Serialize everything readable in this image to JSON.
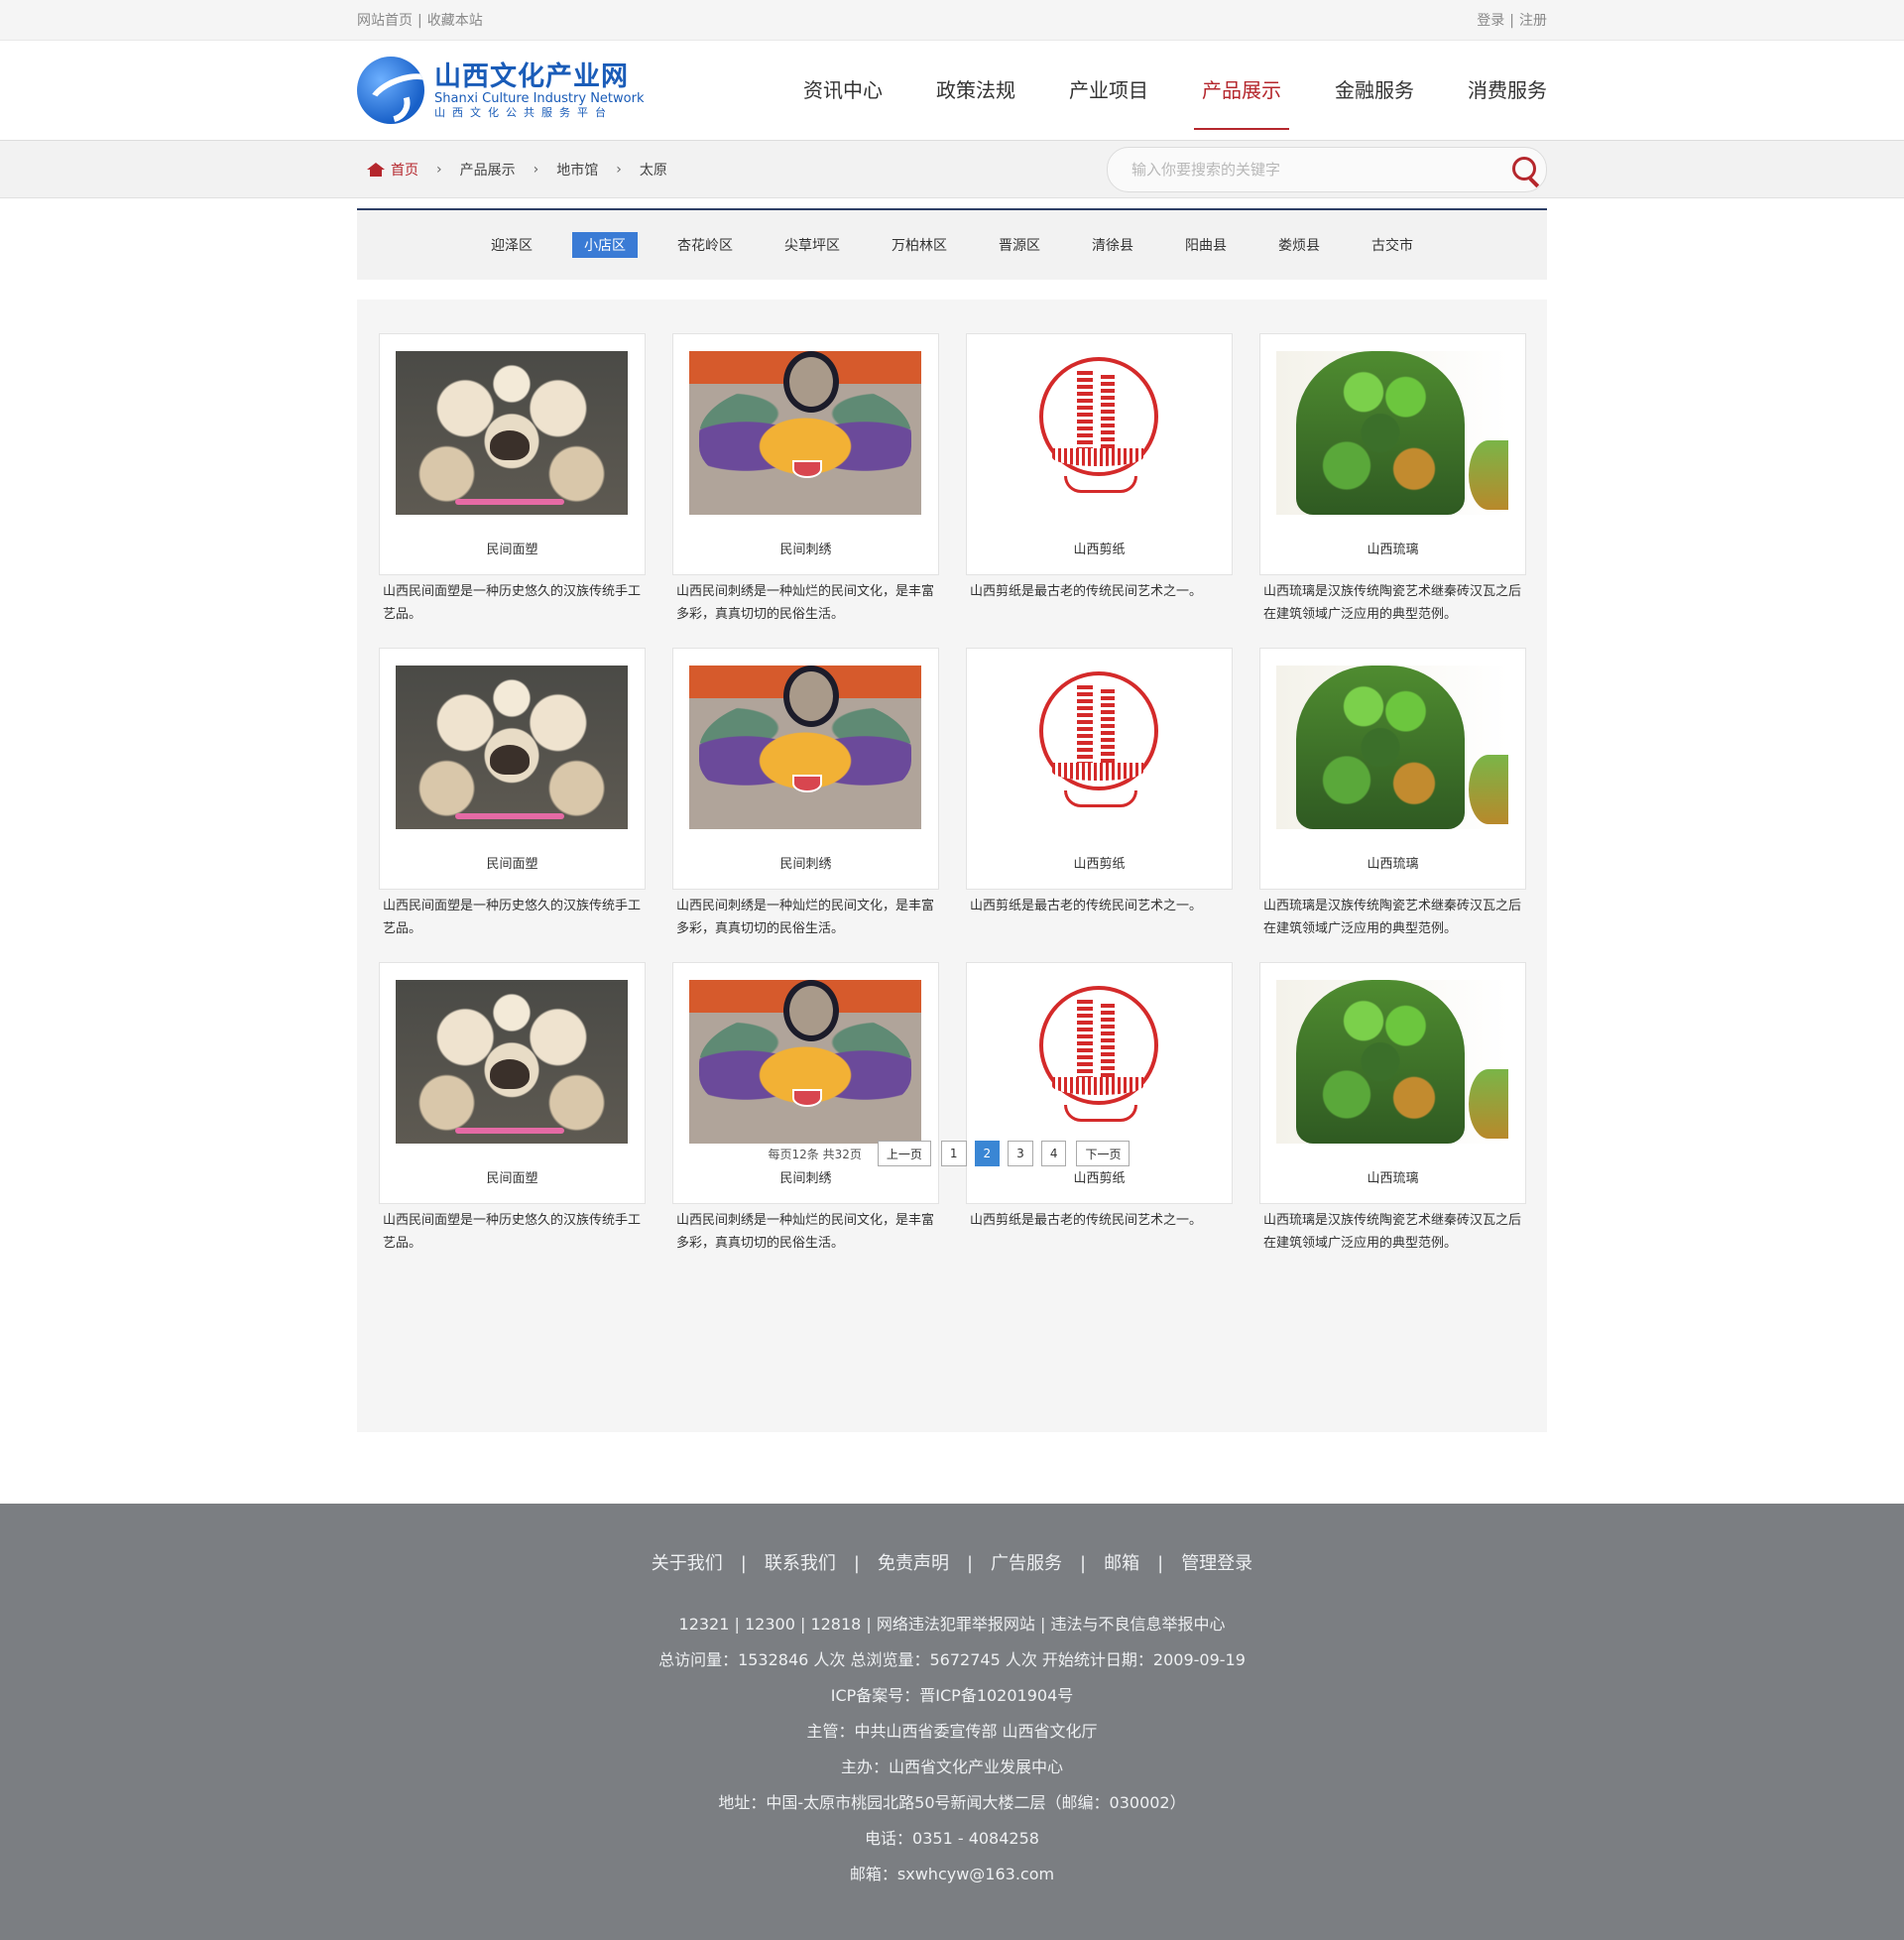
{
  "topbar": {
    "home_link": "网站首页",
    "bookmark_link": "收藏本站",
    "login": "登录",
    "register": "注册"
  },
  "logo": {
    "cn": "山西文化产业网",
    "en": "Shanxi Culture Industry Network",
    "sub": "山西文化公共服务平台"
  },
  "nav": [
    {
      "label": "资讯中心"
    },
    {
      "label": "政策法规"
    },
    {
      "label": "产业项目"
    },
    {
      "label": "产品展示"
    },
    {
      "label": "金融服务"
    },
    {
      "label": "消费服务"
    }
  ],
  "nav_active_index": 3,
  "breadcrumb": {
    "home": "首页",
    "items": [
      "产品展示",
      "地市馆",
      "太原"
    ]
  },
  "search": {
    "placeholder": "输入你要搜索的关键字"
  },
  "districts": [
    "迎泽区",
    "小店区",
    "杏花岭区",
    "尖草坪区",
    "万柏林区",
    "晋源区",
    "清徐县",
    "阳曲县",
    "娄烦县",
    "古交市"
  ],
  "district_active_index": 1,
  "products": [
    {
      "title": "民间面塑",
      "desc": "山西民间面塑是一种历史悠久的汉族传统手工艺品。",
      "image": "dough-sculpture"
    },
    {
      "title": "民间刺绣",
      "desc": "山西民间刺绣是一种灿烂的民间文化，是丰富多彩，真真切切的民俗生活。",
      "image": "embroidery"
    },
    {
      "title": "山西剪纸",
      "desc": "山西剪纸是最古老的传统民间艺术之一。",
      "image": "paper-cut"
    },
    {
      "title": "山西琉璃",
      "desc": "山西琉璃是汉族传统陶瓷艺术继秦砖汉瓦之后在建筑领域广泛应用的典型范例。",
      "image": "glazed-lion"
    },
    {
      "title": "民间面塑",
      "desc": "山西民间面塑是一种历史悠久的汉族传统手工艺品。",
      "image": "dough-sculpture"
    },
    {
      "title": "民间刺绣",
      "desc": "山西民间刺绣是一种灿烂的民间文化，是丰富多彩，真真切切的民俗生活。",
      "image": "embroidery"
    },
    {
      "title": "山西剪纸",
      "desc": "山西剪纸是最古老的传统民间艺术之一。",
      "image": "paper-cut"
    },
    {
      "title": "山西琉璃",
      "desc": "山西琉璃是汉族传统陶瓷艺术继秦砖汉瓦之后在建筑领域广泛应用的典型范例。",
      "image": "glazed-lion"
    },
    {
      "title": "民间面塑",
      "desc": "山西民间面塑是一种历史悠久的汉族传统手工艺品。",
      "image": "dough-sculpture"
    },
    {
      "title": "民间刺绣",
      "desc": "山西民间刺绣是一种灿烂的民间文化，是丰富多彩，真真切切的民俗生活。",
      "image": "embroidery"
    },
    {
      "title": "山西剪纸",
      "desc": "山西剪纸是最古老的传统民间艺术之一。",
      "image": "paper-cut"
    },
    {
      "title": "山西琉璃",
      "desc": "山西琉璃是汉族传统陶瓷艺术继秦砖汉瓦之后在建筑领域广泛应用的典型范例。",
      "image": "glazed-lion"
    }
  ],
  "pagination": {
    "info": "每页12条 共32页",
    "prev": "上一页",
    "pages": [
      "1",
      "2",
      "3",
      "4"
    ],
    "active_page": "2",
    "next": "下一页"
  },
  "footer": {
    "links": [
      "关于我们",
      "联系我们",
      "免责声明",
      "广告服务",
      "邮箱",
      "管理登录"
    ],
    "lines": [
      "12321 | 12300 | 12818 | 网络违法犯罪举报网站 | 违法与不良信息举报中心",
      "总访问量：1532846 人次  总浏览量：5672745 人次  开始统计日期：2009-09-19",
      "ICP备案号：晋ICP备10201904号",
      "主管：中共山西省委宣传部 山西省文化厅",
      "主办：山西省文化产业发展中心",
      "地址：中国-太原市桃园北路50号新闻大楼二层（邮编：030002）",
      "电话：0351 - 4084258",
      "邮箱：sxwhcyw@163.com"
    ]
  },
  "colors": {
    "accent_red": "#b5272d",
    "active_blue": "#3a7bd5",
    "footer_bg": "#7b7e82"
  }
}
